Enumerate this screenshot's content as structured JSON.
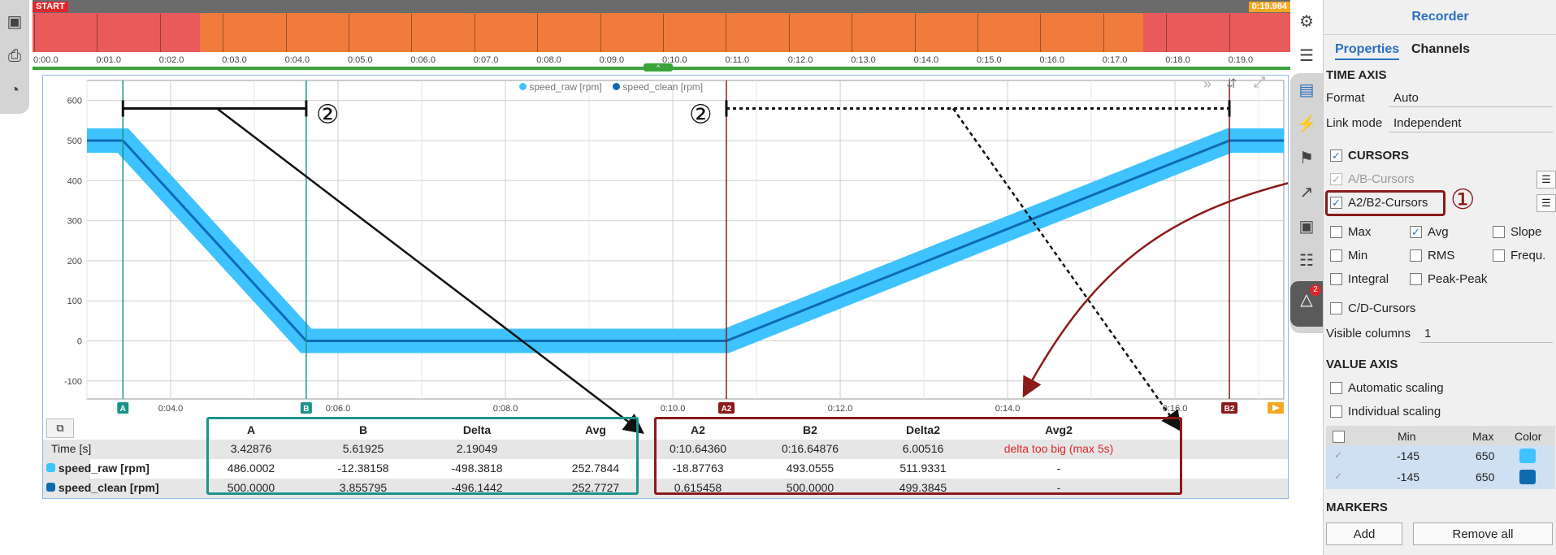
{
  "timeline": {
    "start_label": "START",
    "end_label": "0:19.984",
    "ticks": [
      "0:00.0",
      "0:01.0",
      "0:02.0",
      "0:03.0",
      "0:04.0",
      "0:05.0",
      "0:06.0",
      "0:07.0",
      "0:08.0",
      "0:09.0",
      "0:10.0",
      "0:11.0",
      "0:12.0",
      "0:13.0",
      "0:14.0",
      "0:15.0",
      "0:16.0",
      "0:17.0",
      "0:18.0",
      "0:19.0"
    ]
  },
  "chart_data": {
    "type": "line",
    "legend": [
      "speed_raw [rpm]",
      "speed_clean [rpm]"
    ],
    "series": [
      {
        "name": "speed_raw [rpm]",
        "color": "#3ec3ff",
        "x": [
          3.0,
          3.43,
          5.62,
          10.64,
          16.65,
          17.3
        ],
        "y": [
          500,
          500,
          0,
          0,
          500,
          500
        ]
      },
      {
        "name": "speed_clean [rpm]",
        "color": "#0f6bb0",
        "x": [
          3.0,
          3.43,
          5.62,
          10.64,
          16.65,
          17.3
        ],
        "y": [
          500,
          500,
          0,
          0,
          500,
          500
        ]
      }
    ],
    "yticks": [
      600,
      500,
      400,
      300,
      200,
      100,
      0,
      -100
    ],
    "xticks": [
      "0:04.0",
      "0:06.0",
      "0:08.0",
      "0:10.0",
      "0:12.0",
      "0:14.0",
      "0:16.0"
    ],
    "ylim": [
      -145,
      650
    ],
    "xlim": [
      3.0,
      17.3
    ],
    "grid": true,
    "cursors": [
      {
        "label": "A",
        "x": 3.43,
        "color": "#1a9488"
      },
      {
        "label": "B",
        "x": 5.62,
        "color": "#1a9488"
      },
      {
        "label": "A2",
        "x": 10.64,
        "color": "#8b1a1a"
      },
      {
        "label": "B2",
        "x": 16.65,
        "color": "#8b1a1a"
      }
    ],
    "annotations": [
      "②",
      "②"
    ]
  },
  "cursor_table": {
    "headers": [
      "A",
      "B",
      "Delta",
      "Avg"
    ],
    "headers2": [
      "A2",
      "B2",
      "Delta2",
      "Avg2"
    ],
    "rows": [
      {
        "label": "Time [s]",
        "values": [
          "3.42876",
          "5.61925",
          "2.19049",
          ""
        ],
        "values2": [
          "0:10.64360",
          "0:16.64876",
          "6.00516",
          "delta too big (max 5s)"
        ]
      },
      {
        "label": "speed_raw [rpm]",
        "values": [
          "486.0002",
          "-12.38158",
          "-498.3818",
          "252.7844"
        ],
        "values2": [
          "-18.87763",
          "493.0555",
          "511.9331",
          "-"
        ]
      },
      {
        "label": "speed_clean [rpm]",
        "values": [
          "500.0000",
          "3.855795",
          "-496.1442",
          "252.7727"
        ],
        "values2": [
          "0.615458",
          "500.0000",
          "499.3845",
          "-"
        ]
      }
    ]
  },
  "panel": {
    "title": "Recorder",
    "tabs": [
      "Properties",
      "Channels"
    ],
    "time_axis": {
      "heading": "TIME AXIS",
      "format_label": "Format",
      "format_value": "Auto",
      "link_label": "Link mode",
      "link_value": "Independent"
    },
    "cursors": {
      "heading": "CURSORS",
      "ab": "A/B-Cursors",
      "a2b2": "A2/B2-Cursors",
      "callout": "①",
      "options": [
        "Max",
        "Avg",
        "Slope",
        "Min",
        "RMS",
        "Frequ.",
        "Integral",
        "Peak-Peak"
      ],
      "cd": "C/D-Cursors",
      "visible_label": "Visible columns",
      "visible_value": "1"
    },
    "value_axis": {
      "heading": "VALUE AXIS",
      "auto": "Automatic scaling",
      "individual": "Individual scaling",
      "headers": [
        "Min",
        "Max",
        "Color"
      ],
      "rows": [
        {
          "min": "-145",
          "max": "650",
          "color": "#3ec3ff"
        },
        {
          "min": "-145",
          "max": "650",
          "color": "#0f6bb0"
        }
      ]
    },
    "markers": {
      "heading": "MARKERS",
      "add": "Add",
      "remove": "Remove all"
    }
  },
  "right_strip": {
    "badge": "2"
  }
}
